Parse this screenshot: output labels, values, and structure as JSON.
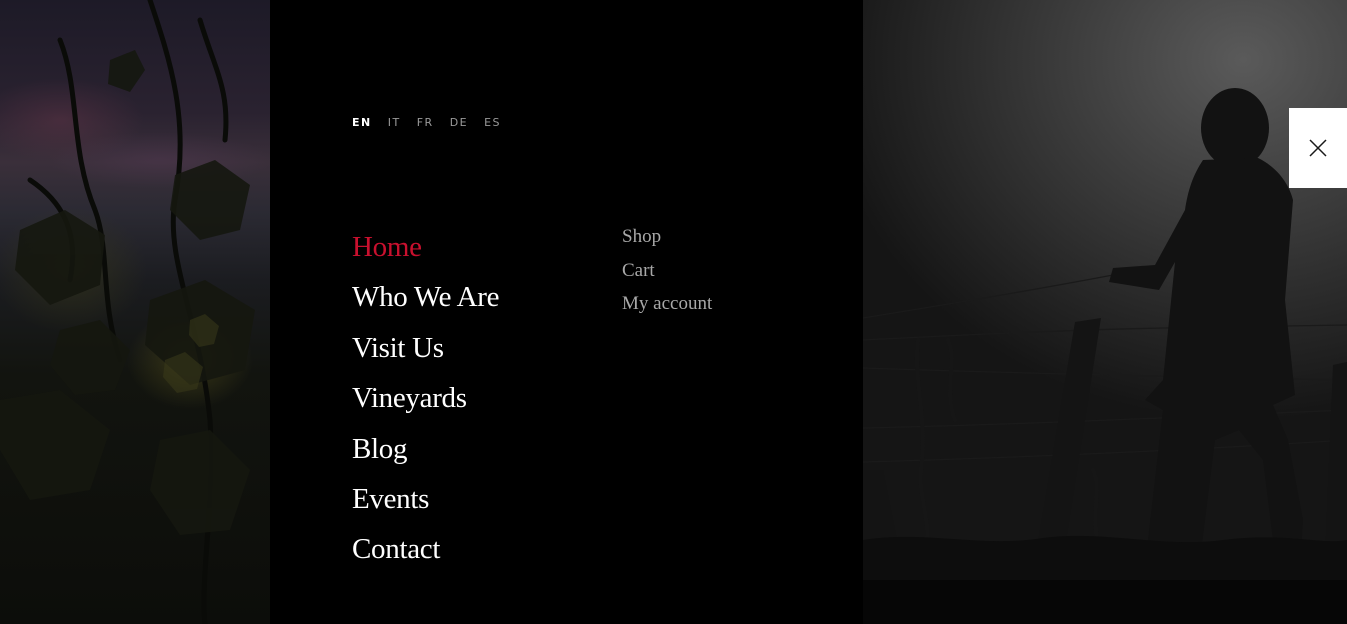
{
  "languages": [
    {
      "code": "EN",
      "active": true
    },
    {
      "code": "IT",
      "active": false
    },
    {
      "code": "FR",
      "active": false
    },
    {
      "code": "DE",
      "active": false
    },
    {
      "code": "ES",
      "active": false
    }
  ],
  "main_nav": [
    {
      "label": "Home",
      "active": true
    },
    {
      "label": "Who We Are",
      "active": false
    },
    {
      "label": "Visit Us",
      "active": false
    },
    {
      "label": "Vineyards",
      "active": false
    },
    {
      "label": "Blog",
      "active": false
    },
    {
      "label": "Events",
      "active": false
    },
    {
      "label": "Contact",
      "active": false
    }
  ],
  "secondary_nav": [
    {
      "label": "Shop"
    },
    {
      "label": "Cart"
    },
    {
      "label": "My account"
    }
  ],
  "colors": {
    "background": "#000000",
    "accent": "#c8102e",
    "text_primary": "#ffffff",
    "text_secondary": "#a8a8a8"
  },
  "icons": {
    "close": "close-icon"
  }
}
